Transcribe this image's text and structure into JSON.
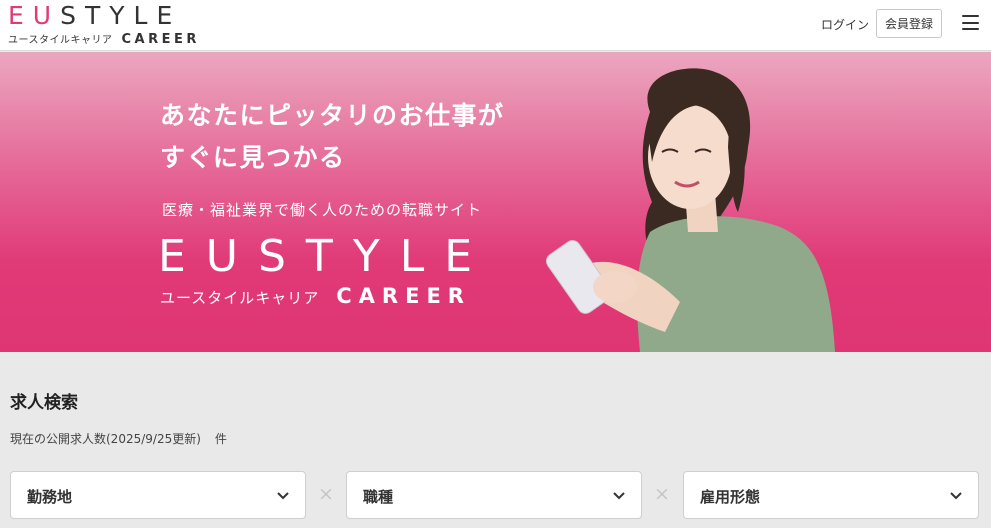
{
  "header": {
    "logo_main_pink": "EU",
    "logo_main_dark": "STYLE",
    "logo_sub_kana": "ユースタイルキャリア",
    "logo_sub_career": "CAREER",
    "login_label": "ログイン",
    "register_label": "会員登録",
    "menu_icon": "hamburger-icon"
  },
  "hero": {
    "headline_line1": "あなたにピッタリのお仕事が",
    "headline_line2": "すぐに見つかる",
    "tagline": "医療・福祉業界で働く人のための転職サイト",
    "logo_main": "EUSTYLE",
    "logo_sub_kana": "ユースタイルキャリア",
    "logo_sub_career": "CAREER",
    "colors": {
      "top": "#eba7bf",
      "bottom": "#df3573"
    }
  },
  "search": {
    "title": "求人検索",
    "count_text": "現在の公開求人数(2025/9/25更新)",
    "count_unit": "件",
    "selects": [
      {
        "label": "勤務地",
        "icon": "chevron-down-icon"
      },
      {
        "label": "職種",
        "icon": "chevron-down-icon"
      },
      {
        "label": "雇用形態",
        "icon": "chevron-down-icon"
      }
    ],
    "separator": "×"
  },
  "colors": {
    "brand_pink": "#e13b77",
    "text_dark": "#333333",
    "page_bg": "#e9e9e9"
  }
}
